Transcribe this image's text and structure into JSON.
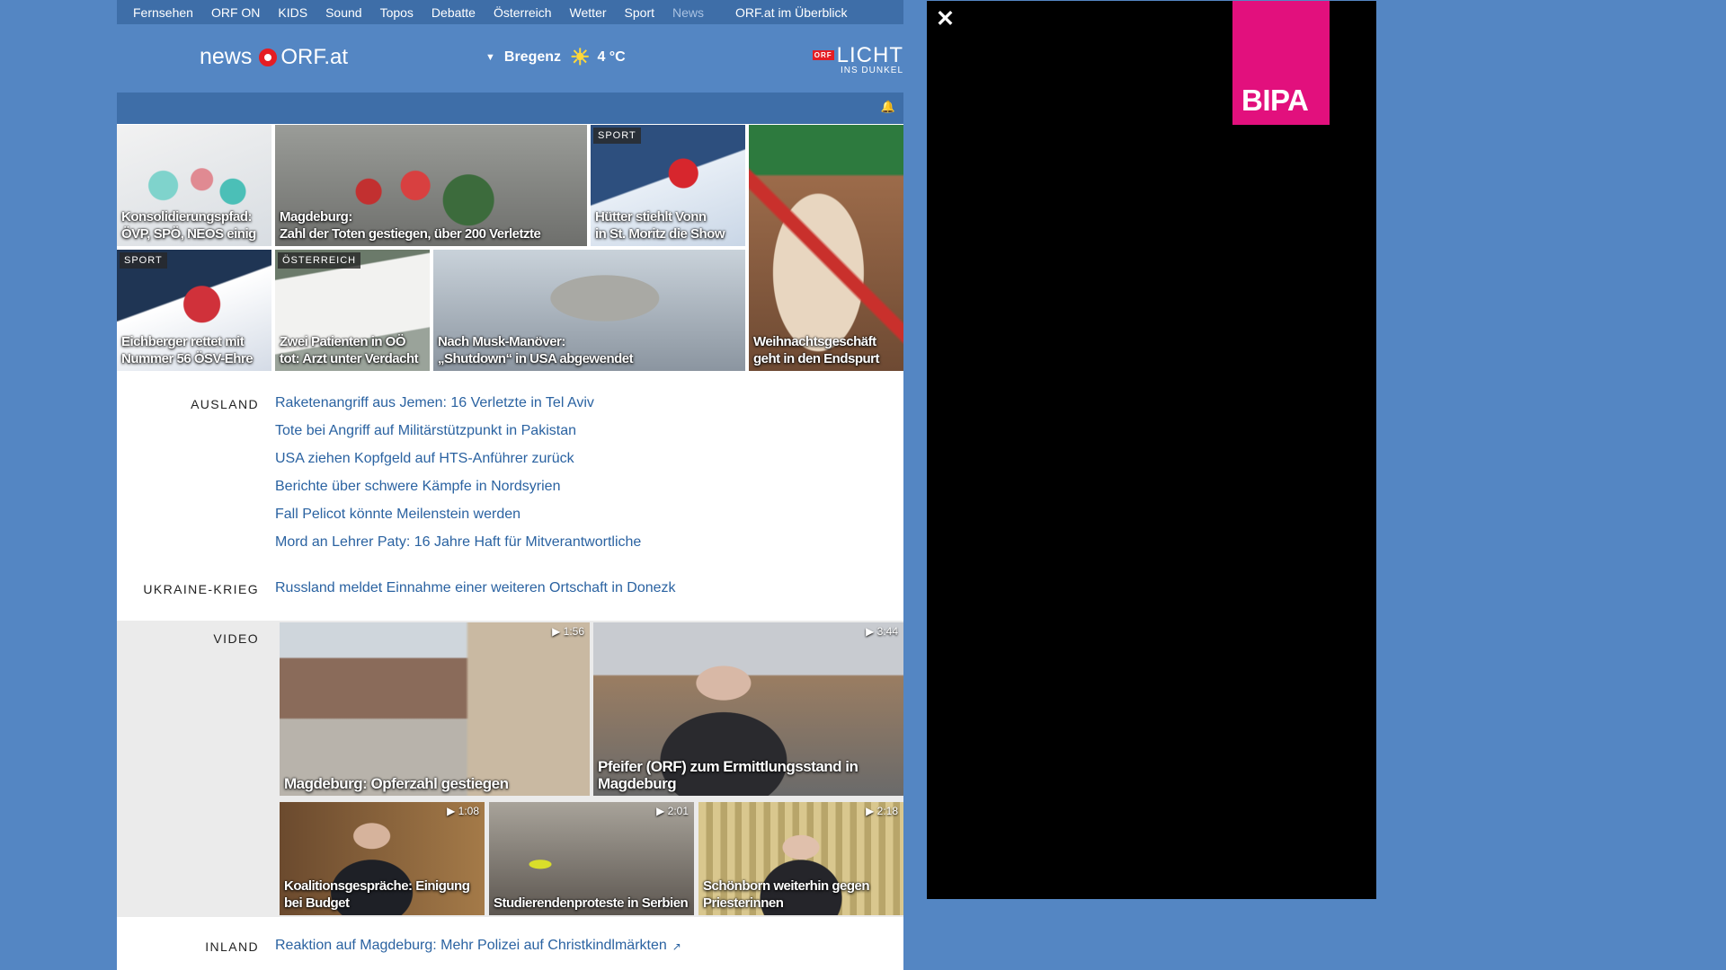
{
  "topnav": {
    "items": [
      "Fernsehen",
      "ORF ON",
      "KIDS",
      "Sound",
      "Topos",
      "Debatte",
      "Österreich",
      "Wetter",
      "Sport",
      "News"
    ],
    "overview": "ORF.at im Überblick"
  },
  "header": {
    "logo_news": "news",
    "logo_orfat": "ORF.at",
    "weather_city": "Bregenz",
    "weather_temp": "4 °C",
    "weather_icon": "sun-icon",
    "licht_badge": "ORF",
    "licht_line1": "LICHT",
    "licht_line2": "INS DUNKEL"
  },
  "tiles": [
    {
      "caption": "Konsolidierungspfad:\nÖVP, SPÖ, NEOS einig",
      "tag": ""
    },
    {
      "caption": "Magdeburg:\nZahl der Toten gestiegen, über 200 Verletzte",
      "tag": ""
    },
    {
      "caption": "Hütter stiehlt Vonn\nin St. Moritz die Show",
      "tag": "SPORT"
    },
    {
      "caption": "Weihnachtsgeschäft\ngeht in den Endspurt",
      "tag": ""
    },
    {
      "caption": "Eichberger rettet mit\nNummer 56 ÖSV-Ehre",
      "tag": "SPORT"
    },
    {
      "caption": "Zwei Patienten in OÖ\ntot: Arzt unter Verdacht",
      "tag": "ÖSTERREICH"
    },
    {
      "caption": "Nach Musk-Manöver:\n„Shutdown“ in USA abgewendet",
      "tag": ""
    }
  ],
  "sections": {
    "ausland": {
      "label": "AUSLAND",
      "links": [
        "Raketenangriff aus Jemen: 16 Verletzte in Tel Aviv",
        "Tote bei Angriff auf Militärstützpunkt in Pakistan",
        "USA ziehen Kopfgeld auf HTS-Anführer zurück",
        "Berichte über schwere Kämpfe in Nordsyrien",
        "Fall Pelicot könnte Meilenstein werden",
        "Mord an Lehrer Paty: 16 Jahre Haft für Mitverantwortliche"
      ]
    },
    "ukraine": {
      "label": "UKRAINE-KRIEG",
      "links": [
        "Russland meldet Einnahme einer weiteren Ortschaft in Donezk"
      ]
    },
    "video": {
      "label": "VIDEO",
      "items": [
        {
          "caption": "Magdeburg: Opferzahl gestiegen",
          "duration": "▶ 1:56"
        },
        {
          "caption": "Pfeifer (ORF) zum Ermittlungsstand in Magdeburg",
          "duration": "▶ 3:44"
        },
        {
          "caption": "Koalitionsgespräche: Einigung bei Budget",
          "duration": "▶ 1:08"
        },
        {
          "caption": "Studierendenproteste in Serbien",
          "duration": "▶ 2:01"
        },
        {
          "caption": "Schönborn weiterhin gegen Priesterinnen",
          "duration": "▶ 2:18"
        }
      ]
    },
    "inland": {
      "label": "INLAND",
      "links": [
        "Reaktion auf Magdeburg: Mehr Polizei auf Christkindlmärkten"
      ]
    }
  },
  "overlay": {
    "close_label": "✕",
    "brand": "BIPA"
  }
}
